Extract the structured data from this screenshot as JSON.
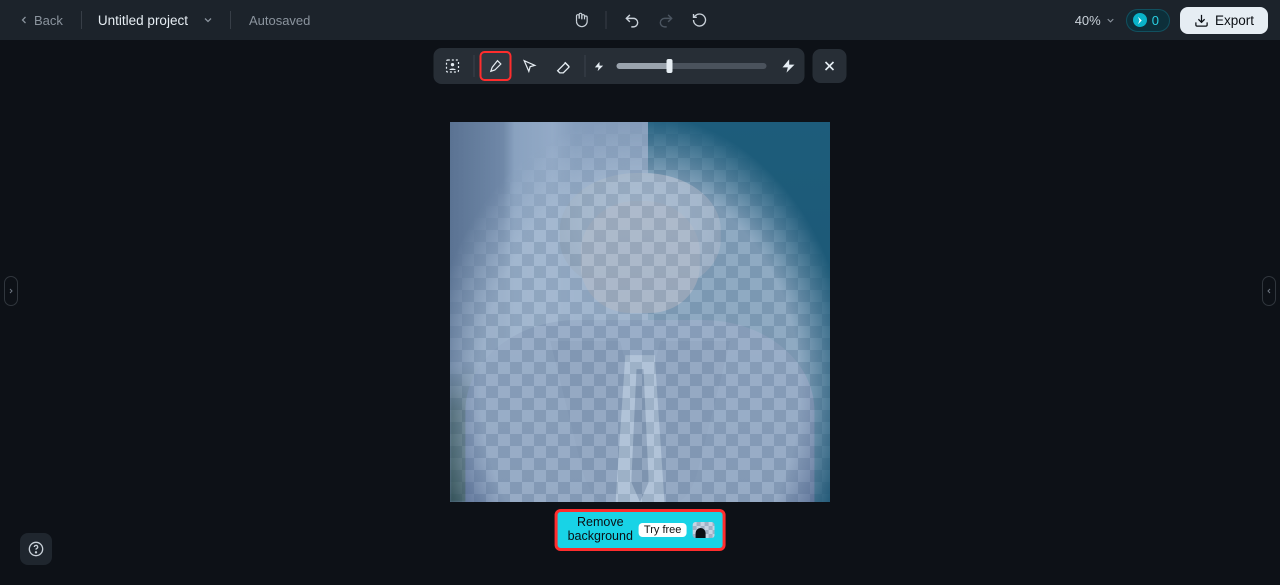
{
  "header": {
    "back_label": "Back",
    "project_name": "Untitled project",
    "autosaved_label": "Autosaved",
    "zoom_label": "40%",
    "credits_value": "0",
    "export_label": "Export"
  },
  "toolbar": {
    "tools": {
      "person_select": "person-select",
      "brush": "brush",
      "lasso": "lasso-select",
      "eraser": "eraser"
    },
    "active_tool": "brush",
    "brush_size_pct": 35
  },
  "canvas": {
    "subject": "portrait-man-grey-hair-suit-tie",
    "overlay": "transparency-checker-mask"
  },
  "remove_bg": {
    "label_line1": "Remove",
    "label_line2": "background",
    "tag": "Try free"
  },
  "icons": {
    "chevron_left": "chevron-left-icon",
    "chevron_down": "chevron-down-icon",
    "hand": "hand-pan-icon",
    "undo": "undo-icon",
    "redo": "redo-icon",
    "reset": "reset-icon",
    "download": "download-icon",
    "close": "close-icon",
    "bolt_small": "bolt-small-icon",
    "bolt_big": "bolt-big-icon",
    "help": "help-icon",
    "credits": "credits-icon"
  }
}
